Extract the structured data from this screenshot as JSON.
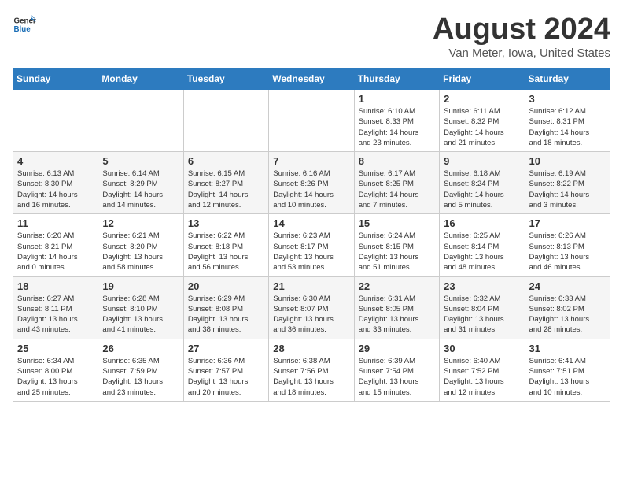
{
  "header": {
    "logo_general": "General",
    "logo_blue": "Blue",
    "month_title": "August 2024",
    "location": "Van Meter, Iowa, United States"
  },
  "weekdays": [
    "Sunday",
    "Monday",
    "Tuesday",
    "Wednesday",
    "Thursday",
    "Friday",
    "Saturday"
  ],
  "weeks": [
    [
      {
        "day": "",
        "info": ""
      },
      {
        "day": "",
        "info": ""
      },
      {
        "day": "",
        "info": ""
      },
      {
        "day": "",
        "info": ""
      },
      {
        "day": "1",
        "info": "Sunrise: 6:10 AM\nSunset: 8:33 PM\nDaylight: 14 hours\nand 23 minutes."
      },
      {
        "day": "2",
        "info": "Sunrise: 6:11 AM\nSunset: 8:32 PM\nDaylight: 14 hours\nand 21 minutes."
      },
      {
        "day": "3",
        "info": "Sunrise: 6:12 AM\nSunset: 8:31 PM\nDaylight: 14 hours\nand 18 minutes."
      }
    ],
    [
      {
        "day": "4",
        "info": "Sunrise: 6:13 AM\nSunset: 8:30 PM\nDaylight: 14 hours\nand 16 minutes."
      },
      {
        "day": "5",
        "info": "Sunrise: 6:14 AM\nSunset: 8:29 PM\nDaylight: 14 hours\nand 14 minutes."
      },
      {
        "day": "6",
        "info": "Sunrise: 6:15 AM\nSunset: 8:27 PM\nDaylight: 14 hours\nand 12 minutes."
      },
      {
        "day": "7",
        "info": "Sunrise: 6:16 AM\nSunset: 8:26 PM\nDaylight: 14 hours\nand 10 minutes."
      },
      {
        "day": "8",
        "info": "Sunrise: 6:17 AM\nSunset: 8:25 PM\nDaylight: 14 hours\nand 7 minutes."
      },
      {
        "day": "9",
        "info": "Sunrise: 6:18 AM\nSunset: 8:24 PM\nDaylight: 14 hours\nand 5 minutes."
      },
      {
        "day": "10",
        "info": "Sunrise: 6:19 AM\nSunset: 8:22 PM\nDaylight: 14 hours\nand 3 minutes."
      }
    ],
    [
      {
        "day": "11",
        "info": "Sunrise: 6:20 AM\nSunset: 8:21 PM\nDaylight: 14 hours\nand 0 minutes."
      },
      {
        "day": "12",
        "info": "Sunrise: 6:21 AM\nSunset: 8:20 PM\nDaylight: 13 hours\nand 58 minutes."
      },
      {
        "day": "13",
        "info": "Sunrise: 6:22 AM\nSunset: 8:18 PM\nDaylight: 13 hours\nand 56 minutes."
      },
      {
        "day": "14",
        "info": "Sunrise: 6:23 AM\nSunset: 8:17 PM\nDaylight: 13 hours\nand 53 minutes."
      },
      {
        "day": "15",
        "info": "Sunrise: 6:24 AM\nSunset: 8:15 PM\nDaylight: 13 hours\nand 51 minutes."
      },
      {
        "day": "16",
        "info": "Sunrise: 6:25 AM\nSunset: 8:14 PM\nDaylight: 13 hours\nand 48 minutes."
      },
      {
        "day": "17",
        "info": "Sunrise: 6:26 AM\nSunset: 8:13 PM\nDaylight: 13 hours\nand 46 minutes."
      }
    ],
    [
      {
        "day": "18",
        "info": "Sunrise: 6:27 AM\nSunset: 8:11 PM\nDaylight: 13 hours\nand 43 minutes."
      },
      {
        "day": "19",
        "info": "Sunrise: 6:28 AM\nSunset: 8:10 PM\nDaylight: 13 hours\nand 41 minutes."
      },
      {
        "day": "20",
        "info": "Sunrise: 6:29 AM\nSunset: 8:08 PM\nDaylight: 13 hours\nand 38 minutes."
      },
      {
        "day": "21",
        "info": "Sunrise: 6:30 AM\nSunset: 8:07 PM\nDaylight: 13 hours\nand 36 minutes."
      },
      {
        "day": "22",
        "info": "Sunrise: 6:31 AM\nSunset: 8:05 PM\nDaylight: 13 hours\nand 33 minutes."
      },
      {
        "day": "23",
        "info": "Sunrise: 6:32 AM\nSunset: 8:04 PM\nDaylight: 13 hours\nand 31 minutes."
      },
      {
        "day": "24",
        "info": "Sunrise: 6:33 AM\nSunset: 8:02 PM\nDaylight: 13 hours\nand 28 minutes."
      }
    ],
    [
      {
        "day": "25",
        "info": "Sunrise: 6:34 AM\nSunset: 8:00 PM\nDaylight: 13 hours\nand 25 minutes."
      },
      {
        "day": "26",
        "info": "Sunrise: 6:35 AM\nSunset: 7:59 PM\nDaylight: 13 hours\nand 23 minutes."
      },
      {
        "day": "27",
        "info": "Sunrise: 6:36 AM\nSunset: 7:57 PM\nDaylight: 13 hours\nand 20 minutes."
      },
      {
        "day": "28",
        "info": "Sunrise: 6:38 AM\nSunset: 7:56 PM\nDaylight: 13 hours\nand 18 minutes."
      },
      {
        "day": "29",
        "info": "Sunrise: 6:39 AM\nSunset: 7:54 PM\nDaylight: 13 hours\nand 15 minutes."
      },
      {
        "day": "30",
        "info": "Sunrise: 6:40 AM\nSunset: 7:52 PM\nDaylight: 13 hours\nand 12 minutes."
      },
      {
        "day": "31",
        "info": "Sunrise: 6:41 AM\nSunset: 7:51 PM\nDaylight: 13 hours\nand 10 minutes."
      }
    ]
  ]
}
